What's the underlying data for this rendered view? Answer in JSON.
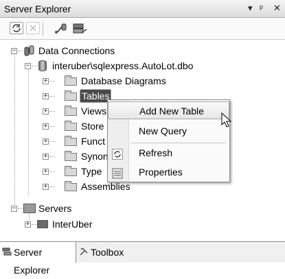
{
  "window": {
    "title": "Server Explorer",
    "controls": [
      "▾",
      "ᵖ",
      "✕"
    ]
  },
  "toolbar": {
    "buttons": [
      "refresh-icon",
      "stop-refresh-icon",
      "connect-to-database-icon",
      "connect-to-server-icon"
    ]
  },
  "tree": {
    "data_connections": "Data Connections",
    "connection": "interuber\\sqlexpress.AutoLot.dbo",
    "folders": [
      "Database Diagrams",
      "Tables",
      "Views",
      "Stored Procedures",
      "Functions",
      "Synonyms",
      "Types",
      "Assemblies"
    ],
    "folders_visible": [
      "Database Diagrams",
      "Tables",
      "Views",
      "Store",
      "Funct",
      "Synon",
      "Type",
      "Assemblies"
    ],
    "servers": "Servers",
    "server_node": "InterUber"
  },
  "context_menu": {
    "items": [
      {
        "label": "Add New Table",
        "icon": ""
      },
      {
        "label": "New Query",
        "icon": ""
      },
      {
        "label": "Refresh",
        "icon": "refresh-icon"
      },
      {
        "label": "Properties",
        "icon": "properties-icon"
      }
    ]
  },
  "bottom_tabs": [
    {
      "label": "Server Explorer",
      "icon": "server-explorer-icon",
      "active": true
    },
    {
      "label": "Toolbox",
      "icon": "toolbox-icon",
      "active": false
    }
  ]
}
